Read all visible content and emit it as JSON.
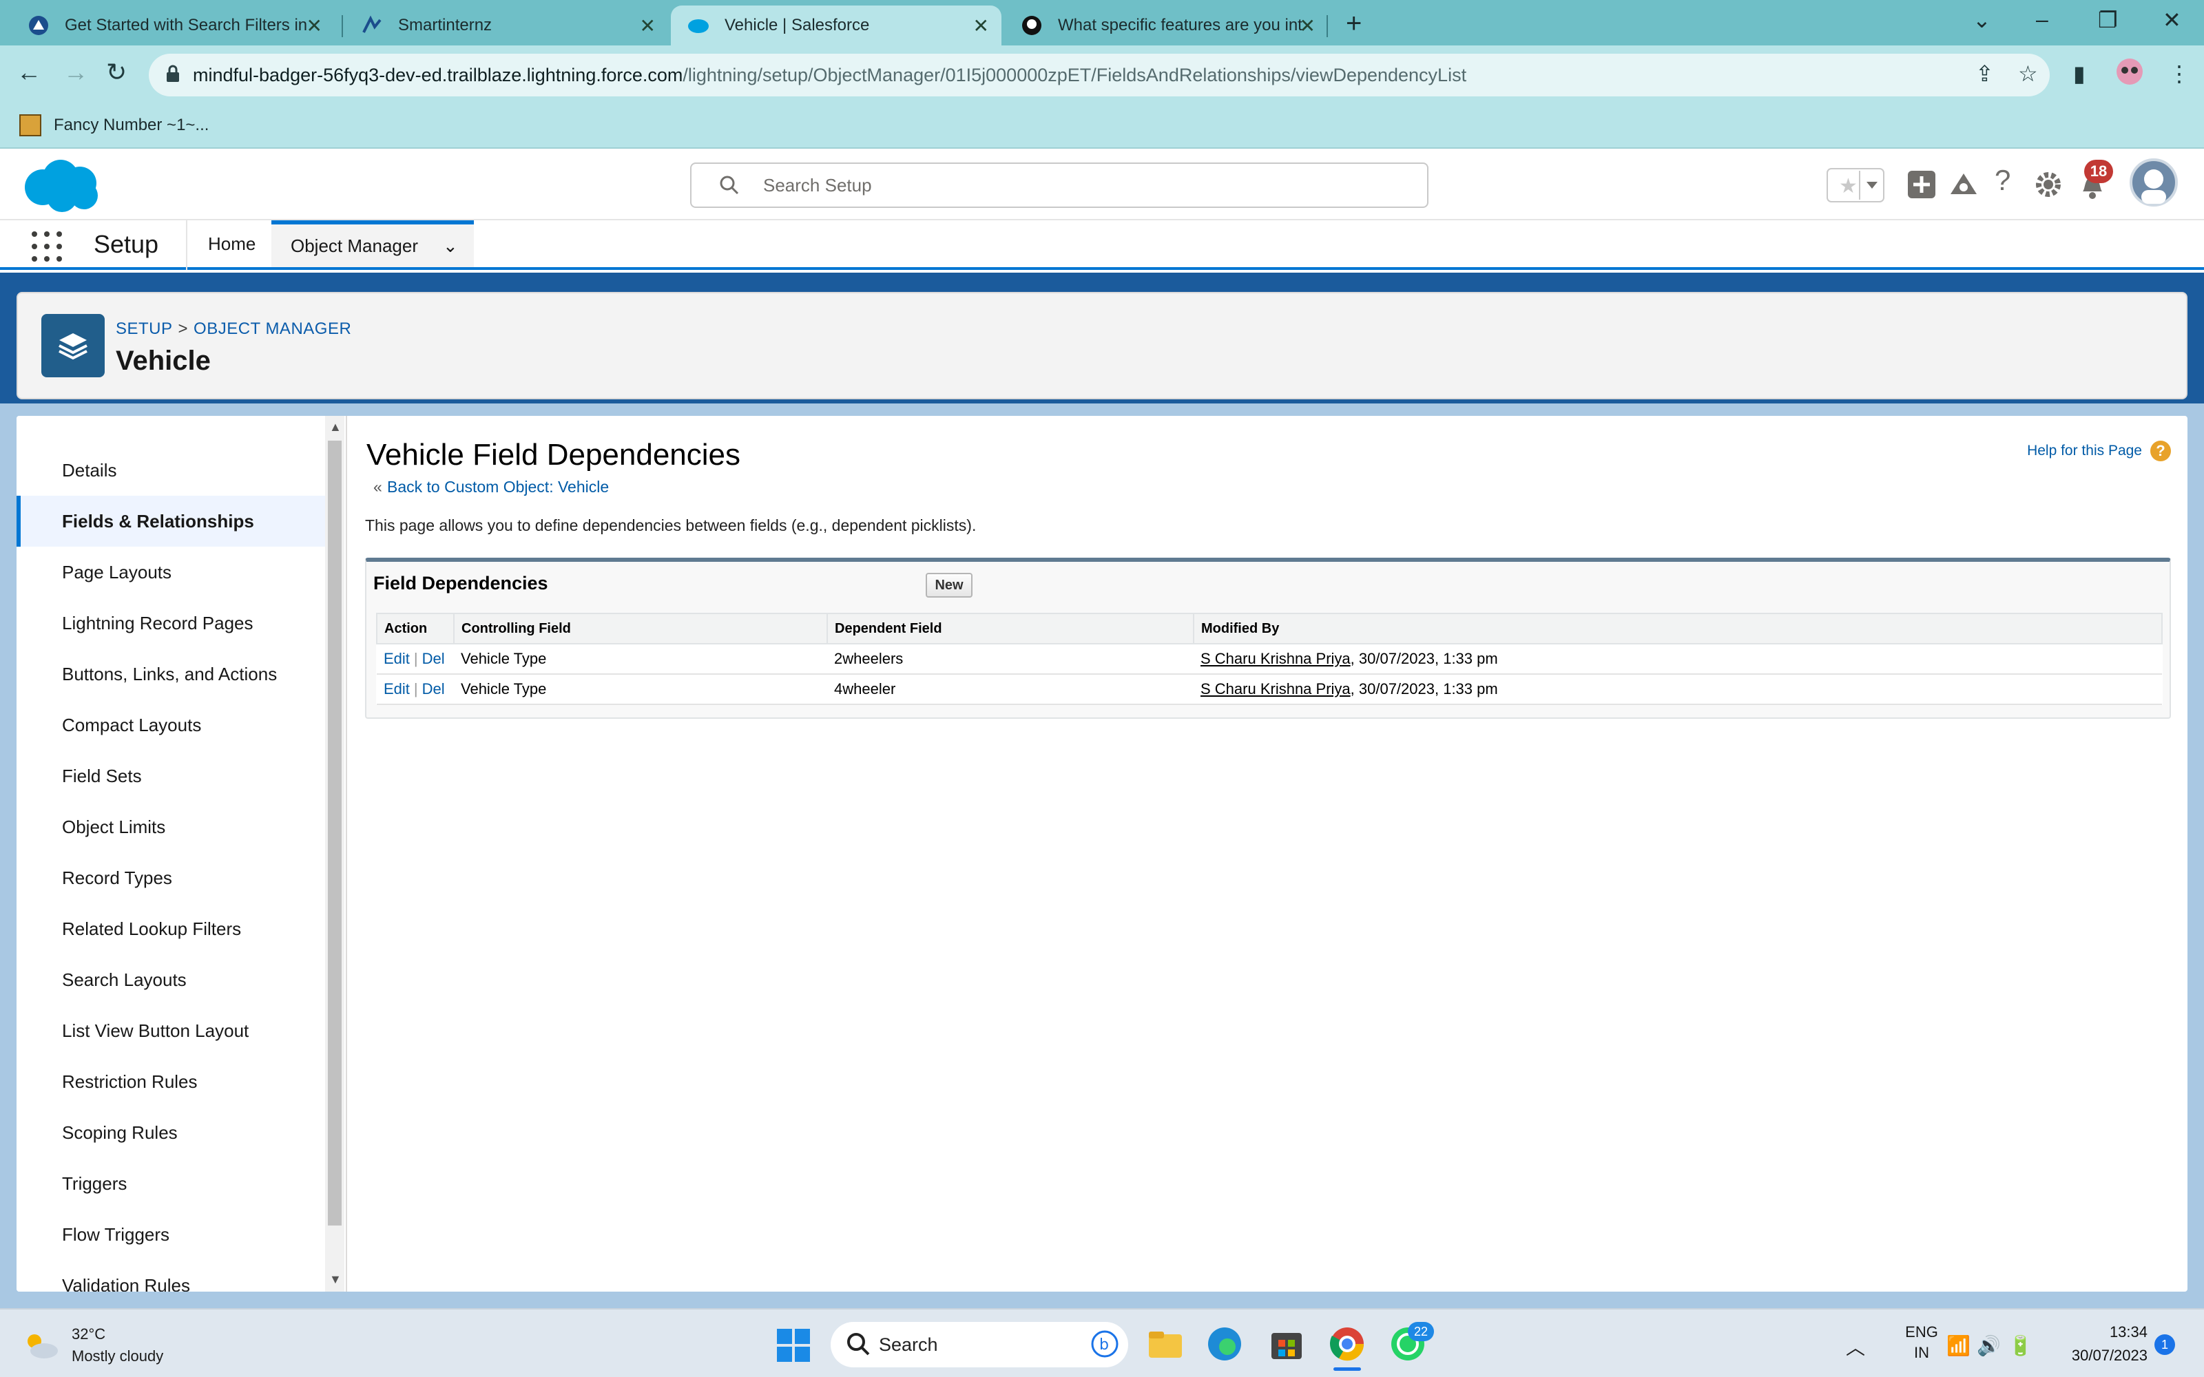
{
  "browser": {
    "tabs": [
      {
        "title": "Get Started with Search Filters in",
        "icon": "trailhead-icon"
      },
      {
        "title": "Smartinternz",
        "icon": "smartinternz-icon"
      },
      {
        "title": "Vehicle | Salesforce",
        "icon": "salesforce-cloud-icon",
        "active": true
      },
      {
        "title": "What specific features are you int",
        "icon": "github-icon"
      }
    ],
    "url_host": "mindful-badger-56fyq3-dev-ed.trailblaze.lightning.force.com",
    "url_path": "/lightning/setup/ObjectManager/01I5j000000zpET/FieldsAndRelationships/viewDependencyList",
    "bookmark": "Fancy Number ~1~..."
  },
  "sf": {
    "search_placeholder": "Search Setup",
    "notification_count": "18",
    "app_name": "Setup",
    "nav": {
      "home": "Home",
      "object_manager": "Object Manager"
    },
    "breadcrumb": {
      "setup": "SETUP",
      "sep": ">",
      "object_manager": "OBJECT MANAGER"
    },
    "object_title": "Vehicle",
    "sidebar": [
      {
        "label": "Details"
      },
      {
        "label": "Fields & Relationships",
        "active": true
      },
      {
        "label": "Page Layouts"
      },
      {
        "label": "Lightning Record Pages"
      },
      {
        "label": "Buttons, Links, and Actions"
      },
      {
        "label": "Compact Layouts"
      },
      {
        "label": "Field Sets"
      },
      {
        "label": "Object Limits"
      },
      {
        "label": "Record Types"
      },
      {
        "label": "Related Lookup Filters"
      },
      {
        "label": "Search Layouts"
      },
      {
        "label": "List View Button Layout"
      },
      {
        "label": "Restriction Rules"
      },
      {
        "label": "Scoping Rules"
      },
      {
        "label": "Triggers"
      },
      {
        "label": "Flow Triggers"
      },
      {
        "label": "Validation Rules"
      }
    ],
    "main": {
      "title": "Vehicle Field Dependencies",
      "back_link": "Back to Custom Object: Vehicle",
      "help_link": "Help for this Page",
      "description": "This page allows you to define dependencies between fields (e.g., dependent picklists).",
      "section_title": "Field Dependencies",
      "new_button": "New",
      "columns": [
        "Action",
        "Controlling Field",
        "Dependent Field",
        "Modified By"
      ],
      "rows": [
        {
          "edit": "Edit",
          "del": "Del",
          "controlling": "Vehicle Type",
          "dependent": "2wheelers",
          "modified_user": "S Charu Krishna Priya",
          "modified_time": ", 30/07/2023, 1:33 pm"
        },
        {
          "edit": "Edit",
          "del": "Del",
          "controlling": "Vehicle Type",
          "dependent": "4wheeler",
          "modified_user": "S Charu Krishna Priya",
          "modified_time": ", 30/07/2023, 1:33 pm"
        }
      ]
    }
  },
  "taskbar": {
    "temperature": "32°C",
    "weather": "Mostly cloudy",
    "search_placeholder": "Search",
    "whatsapp_badge": "22",
    "language": "ENG",
    "region": "IN",
    "time": "13:34",
    "date": "30/07/2023",
    "notification_count": "1"
  },
  "colors": {
    "tab_strip": "#6fbfc7",
    "toolbar": "#b7e4e8",
    "salesforce_blue": "#0176d3",
    "link": "#015ba7"
  }
}
